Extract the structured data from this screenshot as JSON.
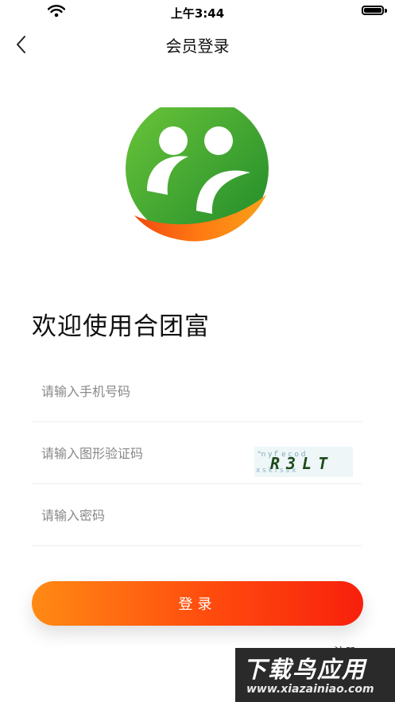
{
  "status_bar": {
    "time": "上午3:44"
  },
  "nav": {
    "title": "会员登录"
  },
  "welcome": "欢迎使用合团富",
  "form": {
    "phone_placeholder": "请输入手机号码",
    "captcha_placeholder": "请输入图形验证码",
    "captcha_text": "R3LT",
    "password_placeholder": "请输入密码"
  },
  "login_label": "登录",
  "register_label": "注册",
  "watermark": {
    "title": "下载鸟应用",
    "url": "www.xiazainiao.com"
  },
  "colors": {
    "brand_green": "#2c9b2c",
    "brand_orange": "#ff7a12",
    "button_red": "#f8200c"
  }
}
